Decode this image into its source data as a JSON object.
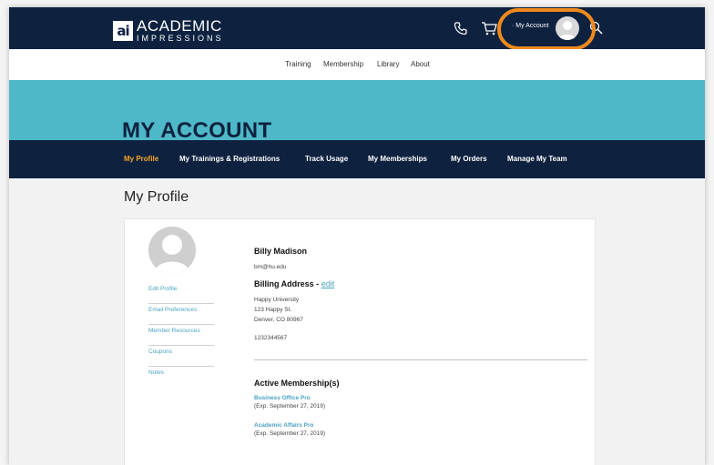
{
  "brand": {
    "mark": "ai",
    "name_main": "ACADEMIC",
    "name_sub": "IMPRESSIONS"
  },
  "header": {
    "account_label": "· My Account",
    "icons": [
      "phone-icon",
      "cart-icon",
      "avatar",
      "search-icon"
    ],
    "highlight_color": "#f08a1c"
  },
  "main_nav": {
    "items": [
      "Training",
      "Membership",
      "Library",
      "About"
    ]
  },
  "hero": {
    "title": "MY ACCOUNT",
    "color": "#4eb8c8"
  },
  "sub_nav": {
    "items": [
      "My Profile",
      "My Trainings & Registrations",
      "Track Usage",
      "My Memberships",
      "My Orders",
      "Manage My Team"
    ],
    "active": "My Profile",
    "active_color": "#f5a623"
  },
  "page": {
    "title": "My Profile"
  },
  "sidebar": {
    "links": [
      "Edit Profile",
      "Email Preferences",
      "Member Resources",
      "Coupons",
      "Notes"
    ]
  },
  "profile": {
    "name": "Billy Madison",
    "email": "bm@hu.edu",
    "billing_label": "Billing Address - ",
    "billing_edit": "edit",
    "address": [
      "Happy University",
      "123 Happy St.",
      "Denver, CO 80967"
    ],
    "phone": "1232344567"
  },
  "memberships": {
    "heading": "Active Membership(s)",
    "items": [
      {
        "name": "Business Office Pro",
        "exp": "(Exp. September 27, 2019)"
      },
      {
        "name": "Academic Affairs Pro",
        "exp": "(Exp. September 27, 2019)"
      }
    ]
  },
  "colors": {
    "navy": "#0e2240",
    "link": "#4aa3c0"
  }
}
